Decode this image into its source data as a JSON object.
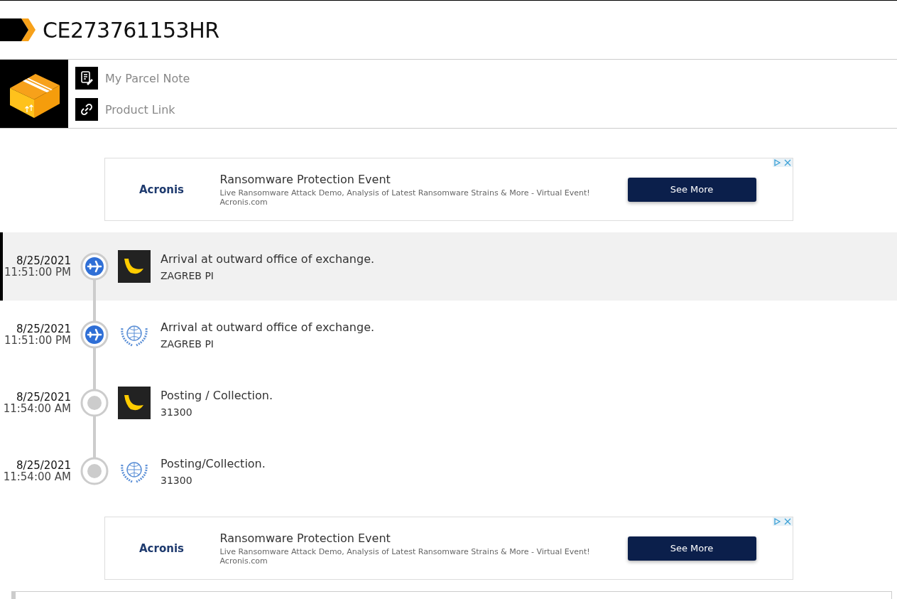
{
  "tracking_number": "CE273761153HR",
  "links": [
    {
      "kind": "note",
      "label": "My Parcel Note"
    },
    {
      "kind": "link",
      "label": "Product Link"
    }
  ],
  "ads": [
    {
      "brand": "Acronis",
      "title": "Ransomware Protection Event",
      "text": "Live Ransomware Attack Demo, Analysis of Latest Ransomware Strains & More - Virtual Event!",
      "domain": "Acronis.com",
      "button": "See More"
    },
    {
      "brand": "Acronis",
      "title": "Ransomware Protection Event",
      "text": "Live Ransomware Attack Demo, Analysis of Latest Ransomware Strains & More - Virtual Event!",
      "domain": "Acronis.com",
      "button": "See More"
    }
  ],
  "events": [
    {
      "date": "8/25/2021",
      "time": "11:51:00 PM",
      "status_icon": {
        "kind": "flight"
      },
      "carrier_logo": {
        "kind": "post"
      },
      "description": "Arrival at outward office of exchange.",
      "location": "ZAGREB PI",
      "selected": true
    },
    {
      "date": "8/25/2021",
      "time": "11:51:00 PM",
      "status_icon": {
        "kind": "flight"
      },
      "carrier_logo": {
        "kind": "upu"
      },
      "description": "Arrival at outward office of exchange.",
      "location": "ZAGREB PI",
      "selected": false
    },
    {
      "date": "8/25/2021",
      "time": "11:54:00 AM",
      "status_icon": {
        "kind": "dot"
      },
      "carrier_logo": {
        "kind": "post"
      },
      "description": "Posting / Collection.",
      "location": "31300",
      "selected": false
    },
    {
      "date": "8/25/2021",
      "time": "11:54:00 AM",
      "status_icon": {
        "kind": "dot"
      },
      "carrier_logo": {
        "kind": "upu"
      },
      "description": "Posting/Collection.",
      "location": "31300",
      "selected": false
    }
  ]
}
